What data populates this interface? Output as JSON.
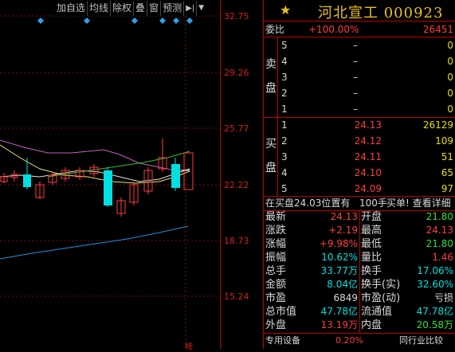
{
  "toolbar": {
    "items": [
      "加自选",
      "均线",
      "除权",
      "叠",
      "窗",
      "预测"
    ],
    "nav_icon": "navigate-icon",
    "dropdown_icon": "chevron-down-icon"
  },
  "axis": {
    "ticks": [
      "32.75",
      "29.26",
      "25.77",
      "22.22",
      "18.73",
      "15.24"
    ],
    "bottom_label": "榜"
  },
  "stock": {
    "name_code": "河北宣工 000923",
    "star_icon": "star-icon"
  },
  "order_book": {
    "weibi_label": "委比",
    "weibi_pct": "+100.00%",
    "weibi_val": "26451",
    "sell_label": [
      "卖",
      "盘"
    ],
    "buy_label": [
      "买",
      "盘"
    ],
    "sell": [
      {
        "level": "5",
        "price": "–",
        "vol": "0"
      },
      {
        "level": "4",
        "price": "–",
        "vol": "0"
      },
      {
        "level": "3",
        "price": "–",
        "vol": "0"
      },
      {
        "level": "2",
        "price": "–",
        "vol": "0"
      },
      {
        "level": "1",
        "price": "–",
        "vol": "0"
      }
    ],
    "buy": [
      {
        "level": "1",
        "price": "24.13",
        "vol": "26129"
      },
      {
        "level": "2",
        "price": "24.12",
        "vol": "109"
      },
      {
        "level": "3",
        "price": "24.11",
        "vol": "51"
      },
      {
        "level": "4",
        "price": "24.10",
        "vol": "65"
      },
      {
        "level": "5",
        "price": "24.09",
        "vol": "97"
      }
    ],
    "info_text": "在买盘24.03位置有",
    "info_qty": "100手",
    "info_link": "买单! 查看详细"
  },
  "quote": {
    "rows": [
      {
        "l1": "最新",
        "v1": "24.13",
        "c1": "red",
        "l2": "开盘",
        "v2": "21.80",
        "c2": "green"
      },
      {
        "l1": "涨跌",
        "v1": "+2.19",
        "c1": "red",
        "l2": "最高",
        "v2": "24.13",
        "c2": "red"
      },
      {
        "l1": "涨幅",
        "v1": "+9.98%",
        "c1": "red",
        "l2": "最低",
        "v2": "21.80",
        "c2": "green"
      },
      {
        "l1": "振幅",
        "v1": "10.62%",
        "c1": "cyan",
        "l2": "量比",
        "v2": "1.46",
        "c2": "red"
      },
      {
        "l1": "总手",
        "v1": "33.77万",
        "c1": "cyan",
        "l2": "换手",
        "v2": "17.06%",
        "c2": "cyan"
      },
      {
        "l1": "金额",
        "v1": "8.04亿",
        "c1": "cyan",
        "l2": "换手(实)",
        "v2": "32.60%",
        "c2": "cyan"
      },
      {
        "l1": "市盈",
        "v1": "6849",
        "c1": "white",
        "l2": "市盈(动)",
        "v2": "亏损",
        "c2": "white"
      },
      {
        "l1": "总市值",
        "v1": "47.78亿",
        "c1": "cyan",
        "l2": "流通值",
        "v2": "47.78亿",
        "c2": "cyan"
      },
      {
        "l1": "外盘",
        "v1": "13.19万",
        "c1": "red",
        "l2": "内盘",
        "v2": "20.58万",
        "c2": "green"
      }
    ]
  },
  "footer": {
    "sector": "专用设备",
    "sector_pct": "0.20%",
    "compare": "同行业比较"
  },
  "colors": {
    "up": "#ff3c3c",
    "down": "#00e0e0",
    "title": "#e8c020",
    "border": "#c00000"
  }
}
